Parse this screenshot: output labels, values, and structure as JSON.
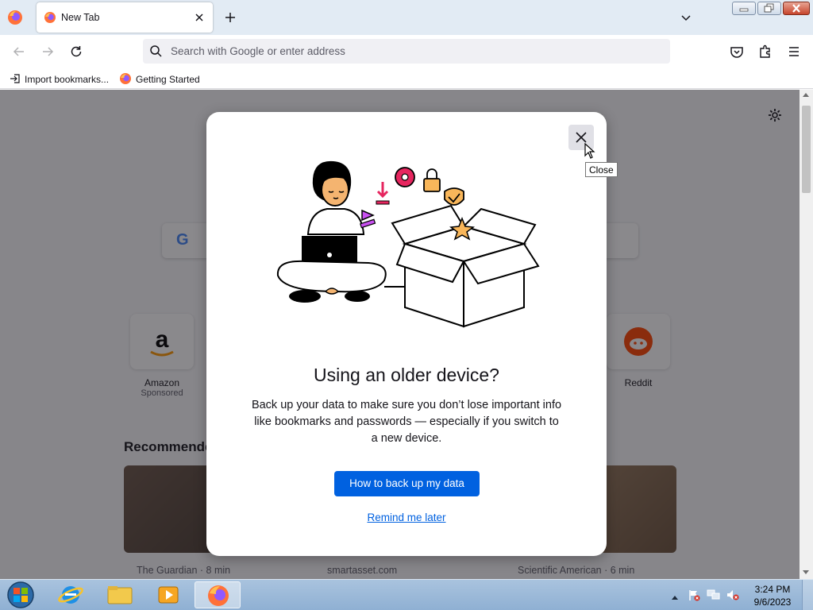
{
  "browser": {
    "tab": {
      "title": "New Tab"
    },
    "urlbar": {
      "placeholder": "Search with Google or enter address"
    },
    "bookmarks": [
      {
        "label": "Import bookmarks..."
      },
      {
        "label": "Getting Started"
      }
    ]
  },
  "page": {
    "shortcuts": [
      {
        "label": "Amazon",
        "sub": "Sponsored"
      },
      {
        "label": "Reddit",
        "sub": ""
      }
    ],
    "recommended_heading": "Recommende",
    "cards": [
      {
        "source": "The Guardian · 8 min"
      },
      {
        "source": "smartasset.com"
      },
      {
        "source": "Scientific American · 6 min"
      }
    ]
  },
  "modal": {
    "title": "Using an older device?",
    "body": "Back up your data to make sure you don’t lose important info like bookmarks and passwords — especially if you switch to a new device.",
    "primary_button": "How to back up my data",
    "secondary_link": "Remind me later",
    "close_tooltip": "Close"
  },
  "taskbar": {
    "time": "3:24 PM",
    "date": "9/6/2023"
  },
  "colors": {
    "accent": "#0061e0",
    "tabstrip": "#e2ebf4",
    "overlay": "rgba(21,20,26,0.5)"
  }
}
